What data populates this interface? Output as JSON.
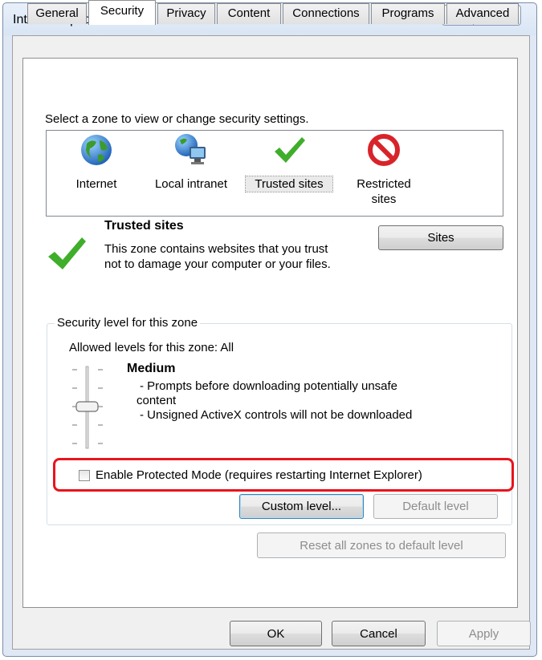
{
  "window": {
    "title": "Internet Options",
    "help_glyph": "?",
    "close_glyph": "✕"
  },
  "tabs": [
    {
      "label": "General",
      "active": false
    },
    {
      "label": "Security",
      "active": true
    },
    {
      "label": "Privacy",
      "active": false
    },
    {
      "label": "Content",
      "active": false
    },
    {
      "label": "Connections",
      "active": false
    },
    {
      "label": "Programs",
      "active": false
    },
    {
      "label": "Advanced",
      "active": false
    }
  ],
  "zones": {
    "prompt": "Select a zone to view or change security settings.",
    "items": [
      {
        "label": "Internet",
        "icon": "globe-icon"
      },
      {
        "label": "Local intranet",
        "icon": "intranet-icon"
      },
      {
        "label": "Trusted sites",
        "icon": "checkmark-icon",
        "selected": true
      },
      {
        "label": "Restricted sites",
        "icon": "no-entry-icon"
      }
    ]
  },
  "selected_zone": {
    "heading": "Trusted sites",
    "description": "This zone contains websites that you trust not to damage your computer or your files.",
    "sites_button": "Sites"
  },
  "security_level": {
    "legend": "Security level for this zone",
    "allowed": "Allowed levels for this zone: All",
    "level_name": "Medium",
    "desc_line1": "- Prompts before downloading potentially unsafe",
    "desc_line2": "content",
    "desc_line3": "- Unsigned ActiveX controls will not be downloaded",
    "protected_mode_label": "Enable Protected Mode (requires restarting Internet Explorer)",
    "protected_mode_checked": false,
    "custom_level_button": "Custom level...",
    "default_level_button": "Default level"
  },
  "reset_button": "Reset all zones to default level",
  "footer": {
    "ok": "OK",
    "cancel": "Cancel",
    "apply": "Apply"
  },
  "colors": {
    "highlight": "#e8141c",
    "check_green": "#3fae2a",
    "no_entry_red": "#d8232a"
  }
}
